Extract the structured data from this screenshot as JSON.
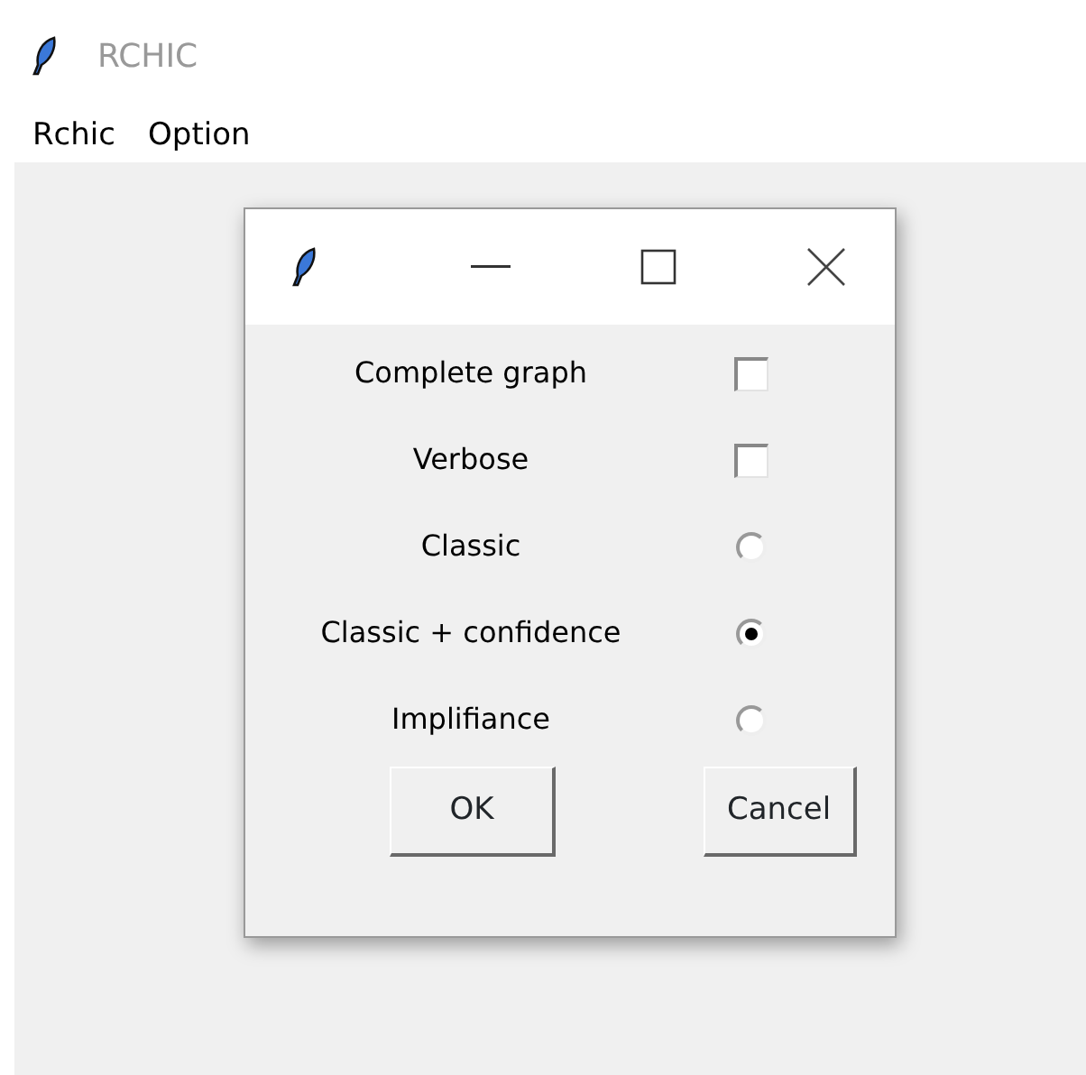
{
  "window": {
    "title": "RCHIC"
  },
  "menu": [
    "Rchic",
    "Option"
  ],
  "dialog": {
    "options": [
      {
        "label": "Complete graph",
        "kind": "checkbox",
        "checked": false
      },
      {
        "label": "Verbose",
        "kind": "checkbox",
        "checked": false
      },
      {
        "label": "Classic",
        "kind": "radio",
        "selected": false
      },
      {
        "label": "Classic + confidence",
        "kind": "radio",
        "selected": true
      },
      {
        "label": "Implifiance",
        "kind": "radio",
        "selected": false
      }
    ],
    "buttons": [
      "OK",
      "Cancel"
    ]
  }
}
